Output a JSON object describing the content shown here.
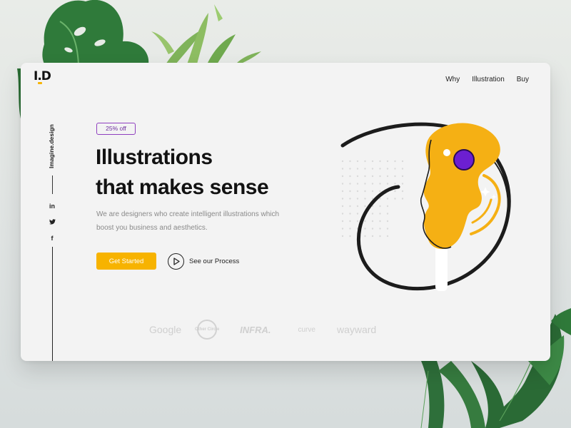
{
  "brand": {
    "logo": "I.D",
    "side_text": "Imagine.design"
  },
  "nav": {
    "items": [
      "Why",
      "Illustration",
      "Buy"
    ]
  },
  "social": {
    "facebook": "f",
    "twitter": "t",
    "linkedin": "in"
  },
  "hero": {
    "badge": "25% off",
    "headline_line1": "Illustrations",
    "headline_line2": "that makes sense",
    "subtitle_line1": "We are designers who create intelligent illustrations which",
    "subtitle_line2": "boost you business and aesthetics.",
    "cta_label": "Get Started",
    "process_label": "See our Process"
  },
  "partners": {
    "items": [
      "Google",
      "Other Circle",
      "INFRA.",
      "curve",
      "wayward"
    ]
  },
  "colors": {
    "accent_yellow": "#f7b300",
    "badge_purple": "#8f3fbf",
    "head_purple": "#6c1fd1"
  },
  "icons": {
    "play": "play-icon",
    "facebook": "facebook-icon",
    "twitter": "twitter-icon",
    "linkedin": "linkedin-icon"
  }
}
